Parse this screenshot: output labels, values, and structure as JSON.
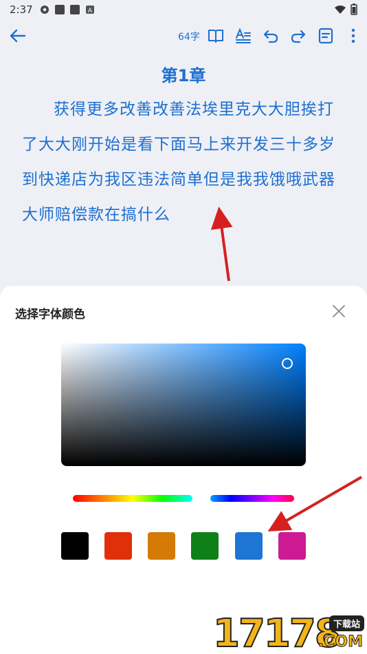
{
  "status_bar": {
    "time": "2:37",
    "icons": [
      "sync-icon",
      "app-icon",
      "app-icon",
      "notification-icon"
    ],
    "right_icons": [
      "wifi-icon",
      "battery-icon"
    ]
  },
  "toolbar": {
    "word_count": "64字",
    "icons": [
      "back-arrow-icon",
      "book-icon",
      "text-format-icon",
      "undo-icon",
      "redo-icon",
      "note-icon",
      "more-vert-icon"
    ]
  },
  "document": {
    "chapter_title": "第1章",
    "paragraph": "获得更多改善改善法埃里克大大胆挨打了大大刚开始是看下面马上来开发三十多岁到快递店为我区违法简单但是我我饿哦武器大师赔偿款在搞什么"
  },
  "color_picker": {
    "title": "选择字体颜色",
    "current_hue": "#0080ff",
    "presets": [
      {
        "name": "black",
        "color": "#000000"
      },
      {
        "name": "red",
        "color": "#e0300b"
      },
      {
        "name": "orange",
        "color": "#d47a05"
      },
      {
        "name": "green",
        "color": "#0f8018"
      },
      {
        "name": "blue",
        "color": "#1e75d3"
      },
      {
        "name": "magenta",
        "color": "#cd1a93"
      }
    ]
  },
  "watermark": {
    "digits": "17178",
    "tag": "下载站",
    "domain": ".COM"
  }
}
